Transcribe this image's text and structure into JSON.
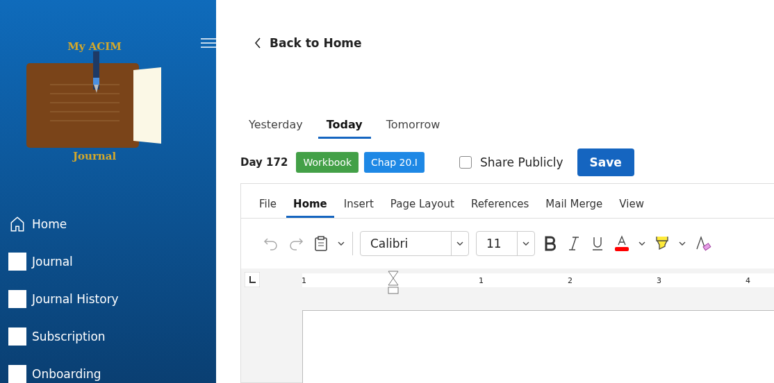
{
  "sidebar": {
    "logo": {
      "title": "My ACIM",
      "subtitle": "Journal"
    },
    "items": [
      {
        "kind": "home",
        "label": "Home"
      },
      {
        "kind": "square",
        "label": "Journal"
      },
      {
        "kind": "square",
        "label": "Journal History"
      },
      {
        "kind": "square",
        "label": "Subscription"
      },
      {
        "kind": "square",
        "label": "Onboarding"
      }
    ]
  },
  "back_link": "Back to Home",
  "day_tabs": [
    {
      "label": "Yesterday",
      "selected": false
    },
    {
      "label": "Today",
      "selected": true
    },
    {
      "label": "Tomorrow",
      "selected": false
    }
  ],
  "entry_bar": {
    "day": "Day 172",
    "tags": [
      {
        "label": "Workbook",
        "color": "#43a047"
      },
      {
        "label": "Chap 20.I",
        "color": "#1e88e5"
      }
    ],
    "share": {
      "label": "Share Publicly",
      "checked": false
    },
    "save": "Save"
  },
  "editor": {
    "ribbon_tabs": [
      {
        "label": "File",
        "selected": false
      },
      {
        "label": "Home",
        "selected": true
      },
      {
        "label": "Insert",
        "selected": false
      },
      {
        "label": "Page Layout",
        "selected": false
      },
      {
        "label": "References",
        "selected": false
      },
      {
        "label": "Mail Merge",
        "selected": false
      },
      {
        "label": "View",
        "selected": false
      }
    ],
    "undo": {
      "disabled": true
    },
    "redo": {
      "disabled": true
    },
    "font": "Calibri",
    "size": "11",
    "ruler": [
      "1",
      "1",
      "2",
      "3",
      "4"
    ]
  }
}
